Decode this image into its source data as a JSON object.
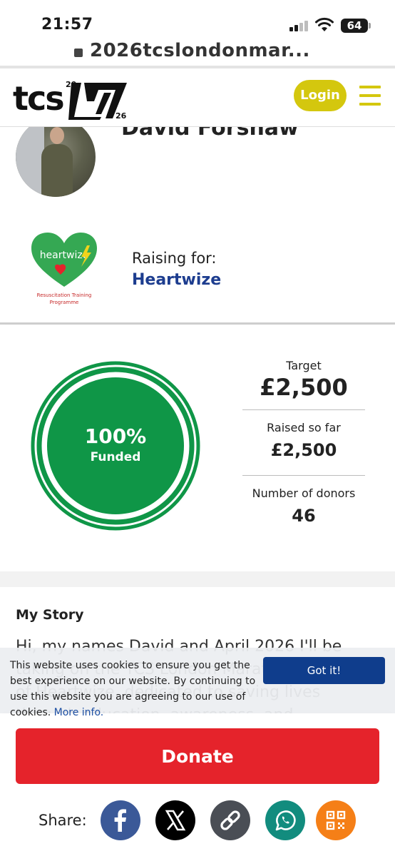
{
  "status_bar": {
    "time": "21:57",
    "battery": "64"
  },
  "browser": {
    "url": "2026tcslondonmar..."
  },
  "header": {
    "logo_text": "tcs",
    "logo_year_top": "20",
    "logo_year_bottom": "26",
    "login_label": "Login"
  },
  "profile": {
    "name": "David Forshaw",
    "raising_for_label": "Raising for:",
    "charity_name": "Heartwize",
    "charity_logo_text": "heartwize",
    "charity_logo_caption_1": "Resuscitation Training",
    "charity_logo_caption_2": "Programme"
  },
  "stats": {
    "percent_funded": "100%",
    "funded_label": "Funded",
    "progress_fraction": 1.0,
    "target_label": "Target",
    "target_value": "£2,500",
    "raised_label": "Raised so far",
    "raised_value": "£2,500",
    "donors_label": "Number of donors",
    "donors_value": "46"
  },
  "story": {
    "title": "My Story",
    "text": "Hi, my names David and April 2026 I'll be taking on the TCS London Marathon in support of Heartwize, dedicated to saving lives through education, awareness, and"
  },
  "cookie_banner": {
    "text": "This website uses cookies to ensure you get the best experience on our website. By continuing to use this website you are agreeing to our use of cookies.",
    "more_info_label": "More info.",
    "accept_label": "Got it!"
  },
  "actions": {
    "donate_label": "Donate",
    "share_label": "Share:"
  },
  "colors": {
    "brand_yellow": "#d4c70e",
    "funded_green": "#0f9647",
    "donate_red": "#e5232b",
    "charity_blue": "#1d3d8f",
    "facebook": "#3b5998",
    "x": "#000000",
    "link": "#4a4e55",
    "whatsapp": "#128c7e",
    "qr": "#f57f17"
  },
  "share_icons": [
    "facebook-icon",
    "x-icon",
    "link-icon",
    "whatsapp-icon",
    "qr-code-icon"
  ]
}
